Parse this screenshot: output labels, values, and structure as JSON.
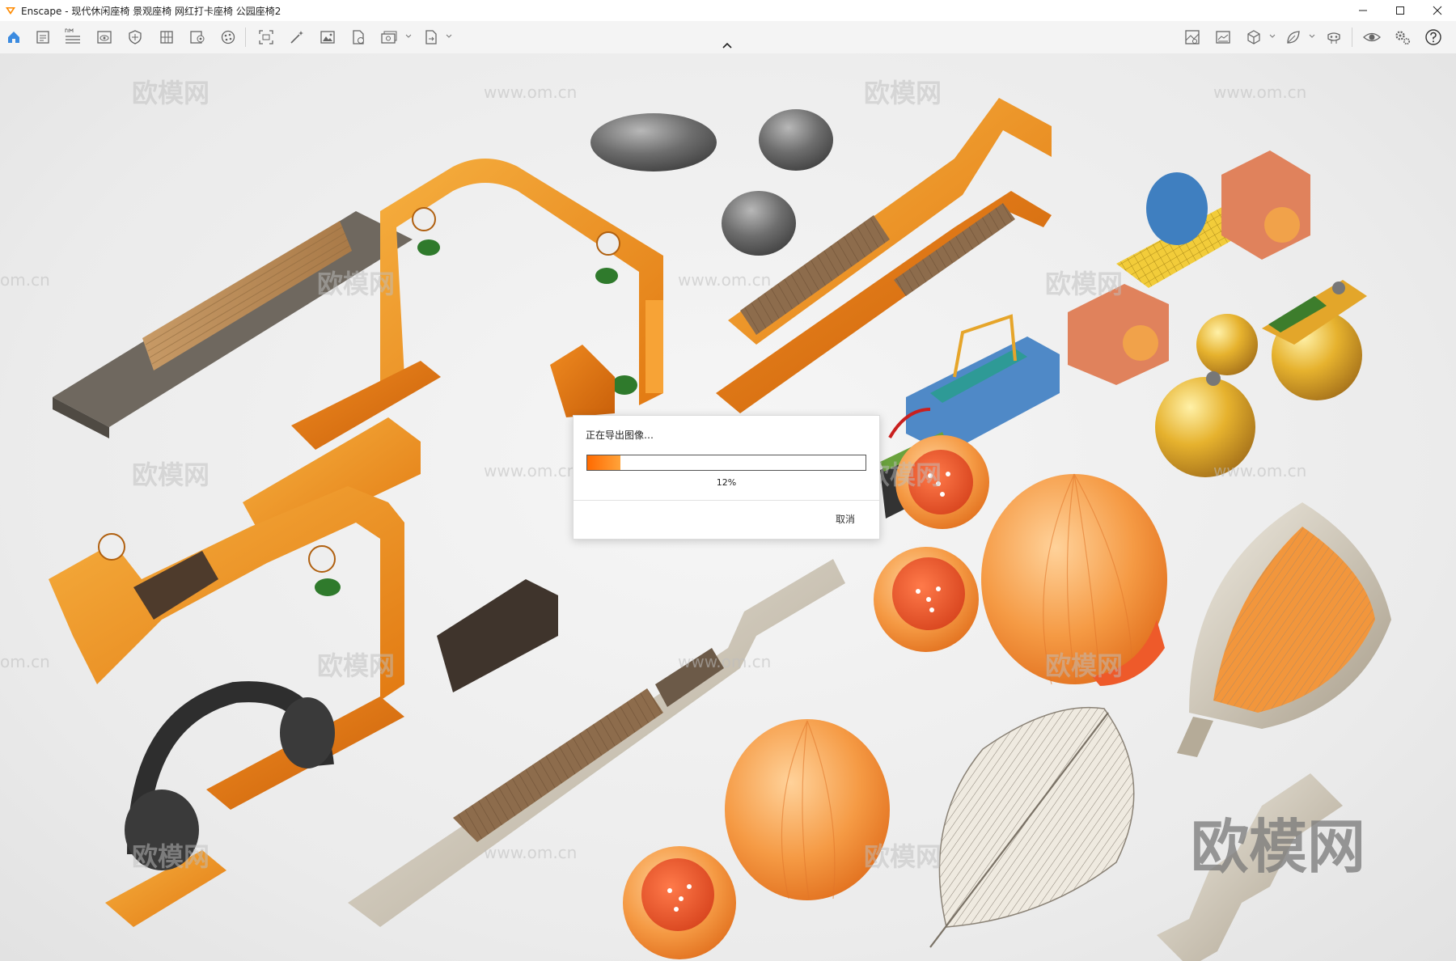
{
  "app": {
    "title": "Enscape - 现代休闲座椅 景观座椅 网红打卡座椅 公园座椅2"
  },
  "colors": {
    "accent": "#ff8a00",
    "progress_start": "#ff6a00",
    "progress_end": "#ffa33a"
  },
  "toolbar": {
    "left_icons": [
      "home-icon",
      "document-icon",
      "bim-icon",
      "list-icon",
      "view-icon",
      "shield-icon",
      "building-icon",
      "image-settings-icon",
      "palette-icon",
      "screenshot-icon",
      "magic-wand-icon",
      "image-icon",
      "file-export-icon",
      "batch-render-icon",
      "export-icon"
    ],
    "right_icons": [
      "asset-library-icon",
      "panorama-icon",
      "cube-icon",
      "leaf-icon",
      "vr-headset-icon",
      "eye-icon",
      "settings-icon",
      "help-icon"
    ]
  },
  "dialog": {
    "title": "正在导出图像…",
    "progress": 12,
    "progress_label": "12%",
    "cancel_label": "取消"
  },
  "watermarks": {
    "small_logo": "欧模网",
    "url": "www.om.cn",
    "url_fragment": "om.cn",
    "large_logo": "欧模网"
  }
}
